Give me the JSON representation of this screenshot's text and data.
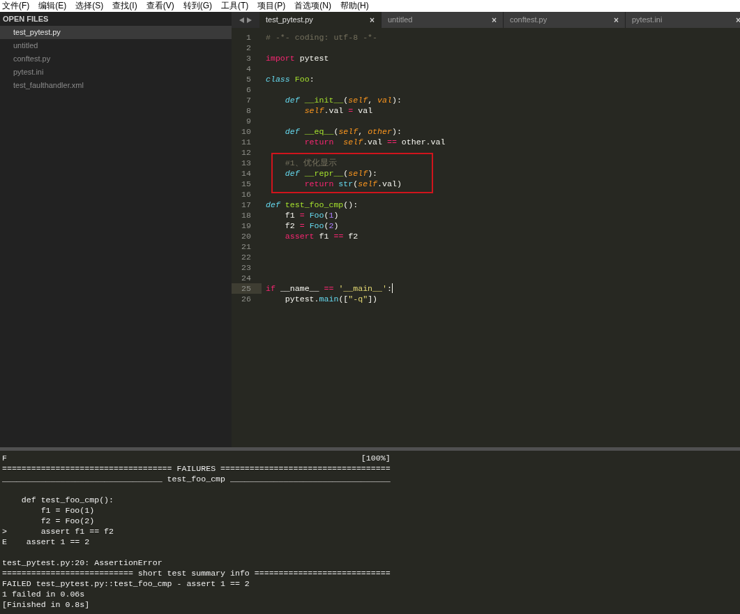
{
  "menu": [
    "文件(F)",
    "编辑(E)",
    "选择(S)",
    "查找(I)",
    "查看(V)",
    "转到(G)",
    "工具(T)",
    "项目(P)",
    "首选项(N)",
    "帮助(H)"
  ],
  "sidebar": {
    "title": "OPEN FILES",
    "items": [
      {
        "label": "test_pytest.py",
        "selected": true
      },
      {
        "label": "untitled",
        "selected": false
      },
      {
        "label": "conftest.py",
        "selected": false
      },
      {
        "label": "pytest.ini",
        "selected": false
      },
      {
        "label": "test_faulthandler.xml",
        "selected": false
      }
    ]
  },
  "tabs": [
    {
      "label": "test_pytest.py",
      "close": "×",
      "selected": true
    },
    {
      "label": "untitled",
      "close": "×",
      "selected": false
    },
    {
      "label": "conftest.py",
      "close": "×",
      "selected": false
    },
    {
      "label": "pytest.ini",
      "close": "×",
      "selected": false
    }
  ],
  "editor": {
    "lines": [
      {
        "n": "1",
        "current": false,
        "boxed": false,
        "tokens": [
          {
            "kind": "comment",
            "text": "# -*- coding: utf-8 -*-"
          }
        ]
      },
      {
        "n": "2",
        "current": false,
        "boxed": false
      },
      {
        "n": "3",
        "current": false,
        "boxed": false,
        "tokens": [
          {
            "kind": "keyword",
            "text": "import"
          },
          {
            "kind": "plain",
            "text": " pytest"
          }
        ]
      },
      {
        "n": "4",
        "current": false,
        "boxed": false
      },
      {
        "n": "5",
        "current": false,
        "boxed": false,
        "tokens": [
          {
            "kind": "storage",
            "text": "class"
          },
          {
            "kind": "entity",
            "text": " Foo"
          },
          {
            "kind": "plain",
            "text": ":"
          }
        ]
      },
      {
        "n": "6",
        "current": false,
        "boxed": false
      },
      {
        "n": "7",
        "current": false,
        "boxed": false,
        "tokens": [
          {
            "kind": "storage",
            "text": "    def"
          },
          {
            "kind": "entity",
            "text": " __init__"
          },
          {
            "kind": "plain",
            "text": "("
          },
          {
            "kind": "param",
            "text": "self"
          },
          {
            "kind": "plain",
            "text": ", "
          },
          {
            "kind": "param",
            "text": "val"
          },
          {
            "kind": "plain",
            "text": "):"
          }
        ]
      },
      {
        "n": "8",
        "current": false,
        "boxed": false,
        "tokens": [
          {
            "kind": "param",
            "text": "        self"
          },
          {
            "kind": "plain",
            "text": ".val "
          },
          {
            "kind": "keyword",
            "text": "="
          },
          {
            "kind": "plain",
            "text": " val"
          }
        ]
      },
      {
        "n": "9",
        "current": false,
        "boxed": false
      },
      {
        "n": "10",
        "current": false,
        "boxed": false,
        "tokens": [
          {
            "kind": "storage",
            "text": "    def"
          },
          {
            "kind": "entity",
            "text": " __eq__"
          },
          {
            "kind": "plain",
            "text": "("
          },
          {
            "kind": "param",
            "text": "self"
          },
          {
            "kind": "plain",
            "text": ", "
          },
          {
            "kind": "param",
            "text": "other"
          },
          {
            "kind": "plain",
            "text": "):"
          }
        ]
      },
      {
        "n": "11",
        "current": false,
        "boxed": false,
        "tokens": [
          {
            "kind": "keyword",
            "text": "        return"
          },
          {
            "kind": "param",
            "text": "  self"
          },
          {
            "kind": "plain",
            "text": ".val "
          },
          {
            "kind": "keyword",
            "text": "=="
          },
          {
            "kind": "plain",
            "text": " other.val"
          }
        ]
      },
      {
        "n": "12",
        "current": false,
        "boxed": false
      },
      {
        "n": "13",
        "current": false,
        "boxed": true,
        "tokens": [
          {
            "kind": "comment",
            "text": "    #1、优化显示"
          }
        ]
      },
      {
        "n": "14",
        "current": false,
        "boxed": true,
        "tokens": [
          {
            "kind": "storage",
            "text": "    def"
          },
          {
            "kind": "entity",
            "text": " __repr__"
          },
          {
            "kind": "plain",
            "text": "("
          },
          {
            "kind": "param",
            "text": "self"
          },
          {
            "kind": "plain",
            "text": "):"
          }
        ]
      },
      {
        "n": "15",
        "current": false,
        "boxed": true,
        "tokens": [
          {
            "kind": "keyword",
            "text": "        return"
          },
          {
            "kind": "support",
            "text": " str"
          },
          {
            "kind": "plain",
            "text": "("
          },
          {
            "kind": "param",
            "text": "self"
          },
          {
            "kind": "plain",
            "text": ".val)"
          }
        ]
      },
      {
        "n": "16",
        "current": false,
        "boxed": false
      },
      {
        "n": "17",
        "current": false,
        "boxed": false,
        "tokens": [
          {
            "kind": "storage",
            "text": "def"
          },
          {
            "kind": "entity",
            "text": " test_foo_cmp"
          },
          {
            "kind": "plain",
            "text": "():"
          }
        ]
      },
      {
        "n": "18",
        "current": false,
        "boxed": false,
        "tokens": [
          {
            "kind": "plain",
            "text": "    f1 "
          },
          {
            "kind": "keyword",
            "text": "="
          },
          {
            "kind": "support",
            "text": " Foo"
          },
          {
            "kind": "plain",
            "text": "("
          },
          {
            "kind": "number",
            "text": "1"
          },
          {
            "kind": "plain",
            "text": ")"
          }
        ]
      },
      {
        "n": "19",
        "current": false,
        "boxed": false,
        "tokens": [
          {
            "kind": "plain",
            "text": "    f2 "
          },
          {
            "kind": "keyword",
            "text": "="
          },
          {
            "kind": "support",
            "text": " Foo"
          },
          {
            "kind": "plain",
            "text": "("
          },
          {
            "kind": "number",
            "text": "2"
          },
          {
            "kind": "plain",
            "text": ")"
          }
        ]
      },
      {
        "n": "20",
        "current": false,
        "boxed": false,
        "tokens": [
          {
            "kind": "keyword",
            "text": "    assert"
          },
          {
            "kind": "plain",
            "text": " f1 "
          },
          {
            "kind": "keyword",
            "text": "=="
          },
          {
            "kind": "plain",
            "text": " f2"
          }
        ]
      },
      {
        "n": "21",
        "current": false,
        "boxed": false
      },
      {
        "n": "22",
        "current": false,
        "boxed": false
      },
      {
        "n": "23",
        "current": false,
        "boxed": false
      },
      {
        "n": "24",
        "current": false,
        "boxed": false
      },
      {
        "n": "25",
        "current": true,
        "boxed": false,
        "tokens": [
          {
            "kind": "keyword",
            "text": "if"
          },
          {
            "kind": "plain",
            "text": " __name__ "
          },
          {
            "kind": "keyword",
            "text": "=="
          },
          {
            "kind": "string",
            "text": " '__main__'"
          },
          {
            "kind": "plain",
            "text": ":"
          }
        ]
      },
      {
        "n": "26",
        "current": false,
        "boxed": false,
        "tokens": [
          {
            "kind": "plain",
            "text": "    pytest."
          },
          {
            "kind": "support",
            "text": "main"
          },
          {
            "kind": "plain",
            "text": "(["
          },
          {
            "kind": "string",
            "text": "\"-q\""
          },
          {
            "kind": "plain",
            "text": "])"
          }
        ]
      }
    ]
  },
  "output": {
    "blocks": [
      [
        "F                                                                         [100%]",
        "=================================== FAILURES ===================================",
        "_________________________________ test_foo_cmp _________________________________"
      ],
      [
        "    def test_foo_cmp():",
        "        f1 = Foo(1)",
        "        f2 = Foo(2)",
        ">       assert f1 == f2",
        "E    assert 1 == 2"
      ],
      [
        "test_pytest.py:20: AssertionError",
        "=========================== short test summary info ============================",
        "FAILED test_pytest.py::test_foo_cmp - assert 1 == 2",
        "1 failed in 0.06s",
        "[Finished in 0.8s]"
      ]
    ]
  }
}
